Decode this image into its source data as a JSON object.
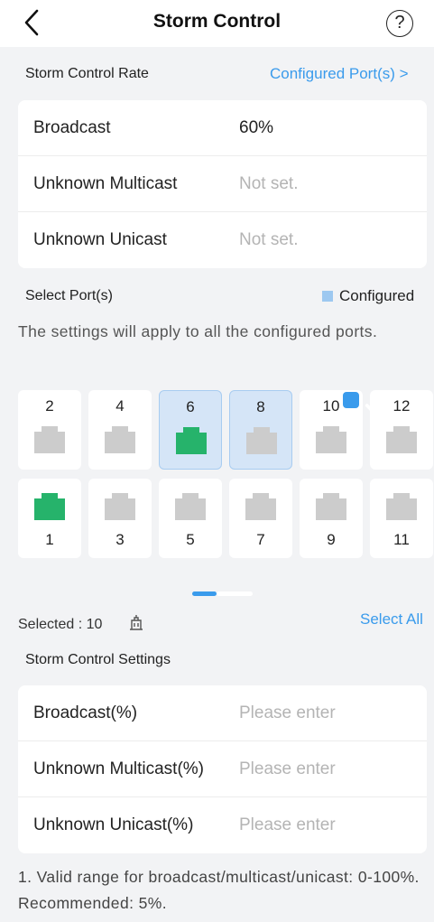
{
  "header": {
    "title": "Storm Control",
    "back_icon": "chevron-left-icon",
    "help_icon": "question-circle-icon",
    "help_glyph": "?"
  },
  "rate_section": {
    "label": "Storm Control Rate",
    "link": "Configured Port(s) >",
    "rows": [
      {
        "label": "Broadcast",
        "value": "60%"
      },
      {
        "label": "Unknown Multicast",
        "value": "Not set."
      },
      {
        "label": "Unknown Unicast",
        "value": "Not set."
      }
    ]
  },
  "port_section": {
    "label": "Select Port(s)",
    "legend": "Configured",
    "legend_color": "#9dc8f0",
    "note": "The settings will apply to all the configured ports.",
    "top_row": [
      {
        "number": "2",
        "state": "off",
        "selected": false,
        "checked": false
      },
      {
        "number": "4",
        "state": "off",
        "selected": false,
        "checked": false
      },
      {
        "number": "6",
        "state": "on",
        "selected": true,
        "checked": false
      },
      {
        "number": "8",
        "state": "off",
        "selected": true,
        "checked": false
      },
      {
        "number": "10",
        "state": "off",
        "selected": false,
        "checked": true
      },
      {
        "number": "12",
        "state": "off",
        "selected": false,
        "checked": false
      }
    ],
    "bottom_row": [
      {
        "number": "1",
        "state": "on"
      },
      {
        "number": "3",
        "state": "off"
      },
      {
        "number": "5",
        "state": "off"
      },
      {
        "number": "7",
        "state": "off"
      },
      {
        "number": "9",
        "state": "off"
      },
      {
        "number": "11",
        "state": "off"
      }
    ],
    "colors": {
      "port_on": "#26b36b",
      "port_off": "#cccccc",
      "selected_bg": "#d5e5f7",
      "accent": "#3a9bec"
    }
  },
  "selection": {
    "selected_text": "Selected : 10",
    "select_all": "Select All",
    "icon": "building-icon"
  },
  "settings_section": {
    "label": "Storm Control Settings",
    "rows": [
      {
        "label": "Broadcast(%)",
        "placeholder": "Please enter"
      },
      {
        "label": "Unknown Multicast(%)",
        "placeholder": "Please enter"
      },
      {
        "label": "Unknown Unicast(%)",
        "placeholder": "Please enter"
      }
    ]
  },
  "footnote": "1. Valid range for broadcast/multicast/unicast: 0-100%. Recommended: 5%."
}
